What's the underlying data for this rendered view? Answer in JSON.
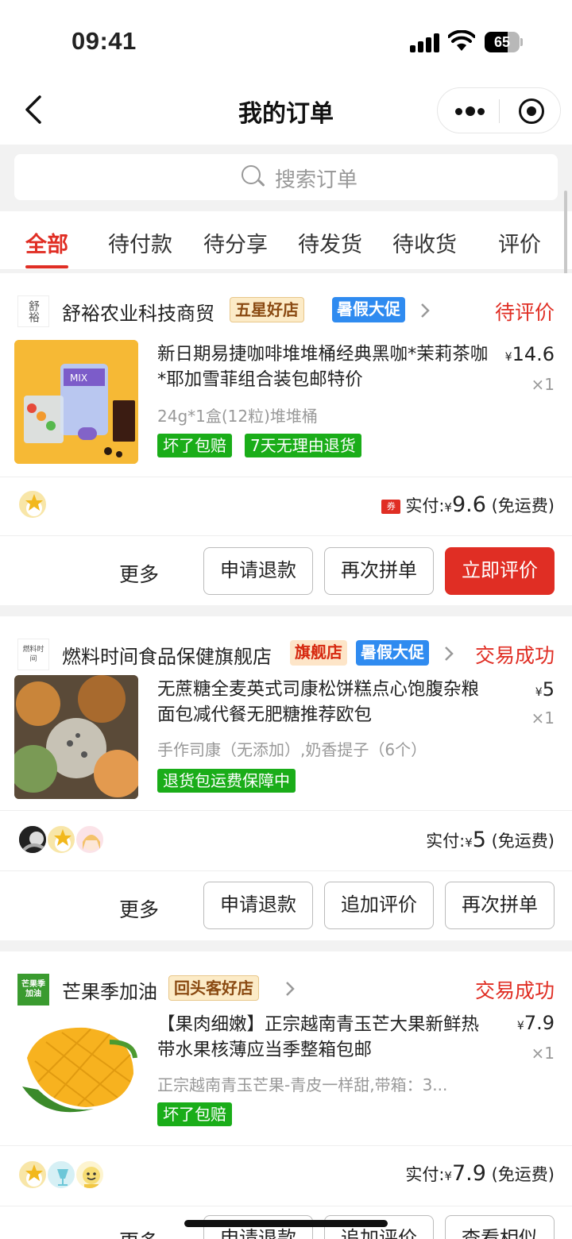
{
  "status_bar": {
    "time": "09:41",
    "battery": "65",
    "battery_level": 0.65
  },
  "nav": {
    "title": "我的订单"
  },
  "search": {
    "placeholder": "搜索订单"
  },
  "tabs": [
    "全部",
    "待付款",
    "待分享",
    "待发货",
    "待收货",
    "评价"
  ],
  "active_tab": "全部",
  "orders": [
    {
      "shop": {
        "name": "舒裕农业科技商贸",
        "logo_text": "舒裕",
        "badges": [
          "五星好店",
          "暑假大促"
        ]
      },
      "status": "待评价",
      "product": {
        "title": "新日期易捷咖啡堆堆桶经典黑咖*茉莉茶咖*耶加雪菲组合装包邮特价",
        "price": "14.6",
        "qty": "×1",
        "spec": "24g*1盒(12粒)堆堆桶",
        "tags": [
          "坏了包赔",
          "7天无理由退货"
        ]
      },
      "paid_label": "实付:",
      "paid_amount": "9.6",
      "shipping": "(免运费)",
      "coupon": "券",
      "actions": {
        "more": "更多",
        "buttons": [
          "申请退款",
          "再次拼单",
          "立即评价"
        ]
      }
    },
    {
      "shop": {
        "name": "燃料时间食品保健旗舰店",
        "logo_text": "燃料时间",
        "badges": [
          "旗舰店",
          "暑假大促"
        ]
      },
      "status": "交易成功",
      "product": {
        "title": "无蔗糖全麦英式司康松饼糕点心饱腹杂粮面包减代餐无肥糖推荐欧包",
        "price": "5",
        "qty": "×1",
        "spec": "手作司康（无添加）,奶香提子（6个）",
        "tags": [
          "退货包运费保障中"
        ]
      },
      "paid_label": "实付:",
      "paid_amount": "5",
      "shipping": "(免运费)",
      "actions": {
        "more": "更多",
        "buttons": [
          "申请退款",
          "追加评价",
          "再次拼单"
        ]
      }
    },
    {
      "shop": {
        "name": "芒果季加油",
        "logo_text": "芒果季加油",
        "badges": [
          "回头客好店"
        ]
      },
      "status": "交易成功",
      "product": {
        "title": "【果肉细嫩】正宗越南青玉芒大果新鲜热带水果核薄应当季整箱包邮",
        "price": "7.9",
        "qty": "×1",
        "spec": "正宗越南青玉芒果-青皮一样甜,带箱：3...",
        "tags": [
          "坏了包赔"
        ]
      },
      "paid_label": "实付:",
      "paid_amount": "7.9",
      "shipping": "(免运费)",
      "actions": {
        "more": "更多",
        "buttons": [
          "申请退款",
          "追加评价",
          "查看相似"
        ]
      }
    }
  ],
  "currency_symbol": "¥",
  "icons": {
    "back": "chevron-left-icon",
    "menu": "more-dots-icon",
    "close": "target-icon",
    "search": "search-icon",
    "shop_arrow": "chevron-right-icon"
  },
  "colors": {
    "accent": "#e02e24",
    "tag_green": "#1aad19",
    "promo_blue": "#2f8bf0"
  }
}
